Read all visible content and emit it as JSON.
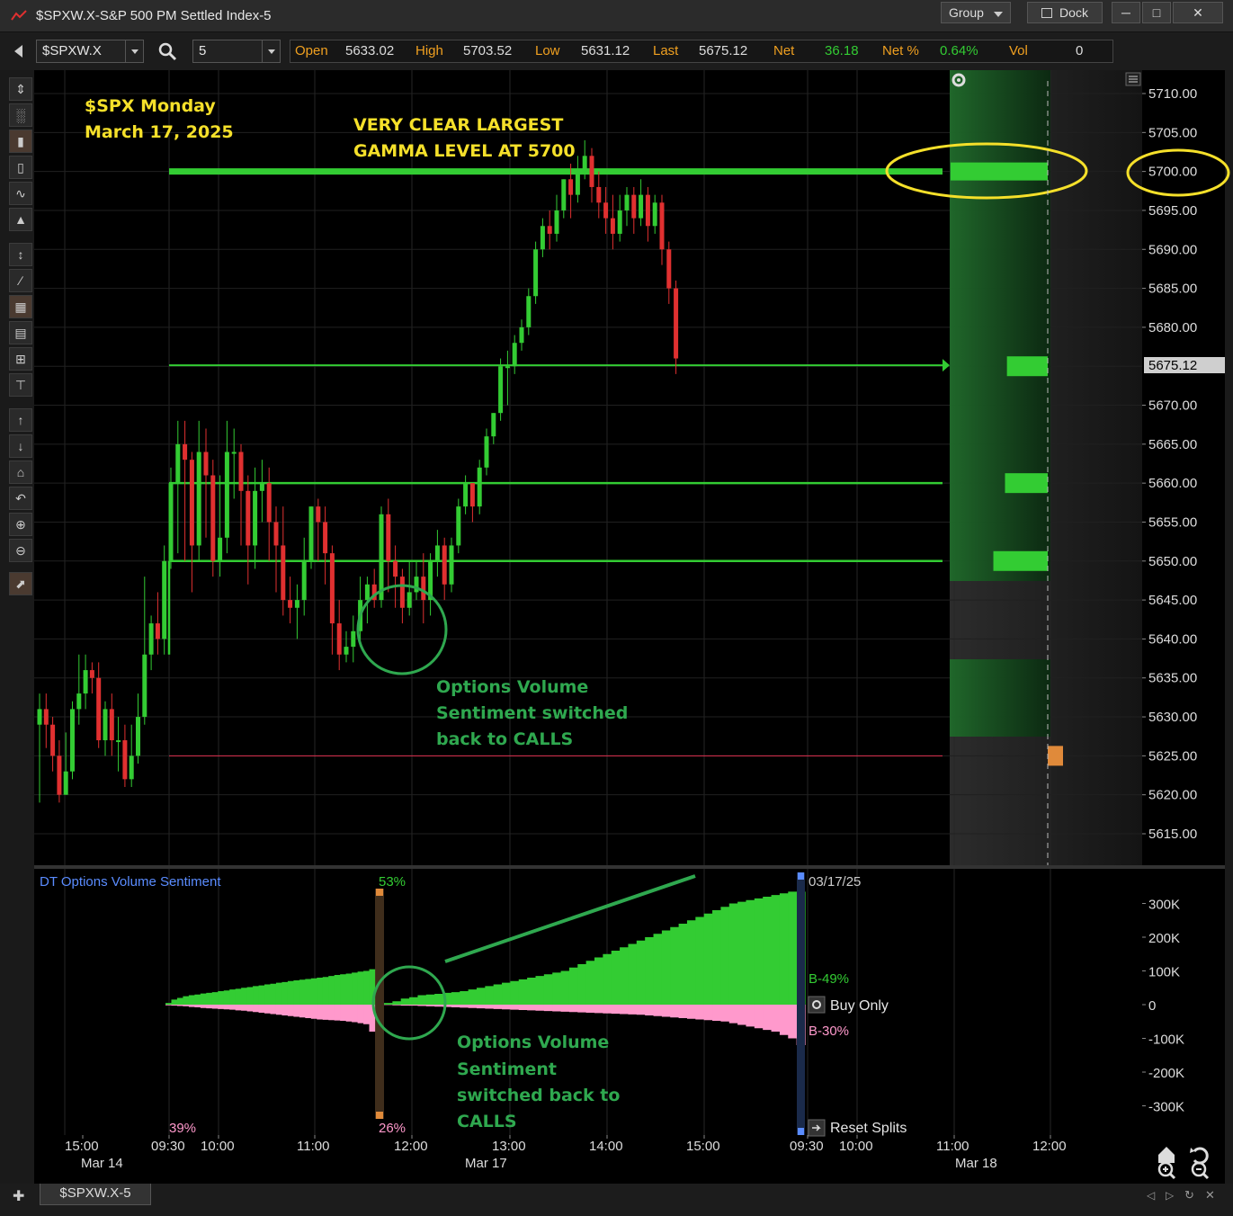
{
  "window": {
    "title": "$SPXW.X-S&P 500 PM Settled Index-5",
    "group_label": "Group",
    "dock_label": "Dock"
  },
  "toolbar": {
    "symbol": "$SPXW.X",
    "interval": "5",
    "quotes": [
      {
        "label": "Open",
        "value": "5633.02"
      },
      {
        "label": "High",
        "value": "5703.52"
      },
      {
        "label": "Low",
        "value": "5631.12"
      },
      {
        "label": "Last",
        "value": "5675.12"
      },
      {
        "label": "Net",
        "value": "36.18"
      },
      {
        "label": "Net %",
        "value": "0.64%"
      },
      {
        "label": "Vol",
        "value": "0"
      }
    ]
  },
  "colors": {
    "up": "#33cc33",
    "down": "#e03030",
    "annotation_yellow": "#f5e02a",
    "annotation_green": "#2fa84f",
    "sentiment_call": "#33cc33",
    "sentiment_put": "#ff99cc",
    "label_blue": "#5a8cff"
  },
  "annotations": {
    "title_line1": "$SPX Monday",
    "title_line2": "March 17, 2025",
    "gamma_line1": "VERY CLEAR LARGEST",
    "gamma_line2": "GAMMA LEVEL AT 5700",
    "sentiment_top": [
      "Options Volume",
      "Sentiment switched",
      "back to CALLS"
    ],
    "sentiment_bottom": [
      "Options Volume",
      "Sentiment",
      "switched back to",
      "CALLS"
    ]
  },
  "price_panel": {
    "last_price_label": "5675.12",
    "ylabels": [
      "5710.00",
      "5705.00",
      "5700.00",
      "5695.00",
      "5690.00",
      "5685.00",
      "5680.00",
      "5675.12",
      "5670.00",
      "5665.00",
      "5660.00",
      "5655.00",
      "5650.00",
      "5645.00",
      "5640.00",
      "5635.00",
      "5630.00",
      "5625.00",
      "5620.00",
      "5615.00"
    ]
  },
  "sentiment_panel": {
    "title": "DT Options Volume Sentiment",
    "date_label": "03/17/25",
    "pct_top": "53%",
    "pct_left": "39%",
    "pct_mid": "26%",
    "b_call": "B-49%",
    "b_put": "B-30%",
    "buy_only": "Buy Only",
    "reset_splits": "Reset Splits",
    "ylabels": [
      "300K",
      "200K",
      "100K",
      "0",
      "-100K",
      "-200K",
      "-300K"
    ]
  },
  "time_axis": {
    "times": [
      "15:00",
      "09:30",
      "10:00",
      "11:00",
      "12:00",
      "13:00",
      "14:00",
      "15:00",
      "09:30",
      "10:00",
      "11:00",
      "12:00"
    ],
    "dates": [
      "Mar 14",
      "Mar 17",
      "Mar 18"
    ]
  },
  "tab": {
    "label": "$SPXW.X-5"
  },
  "chart_data": {
    "type": "candlestick",
    "symbol": "$SPXW.X",
    "interval_minutes": 5,
    "ylim": [
      5612,
      5714
    ],
    "open": 5633.02,
    "high": 5703.52,
    "low": 5631.12,
    "last": 5675.12,
    "levels": [
      {
        "price": 5700,
        "label": "Largest gamma"
      },
      {
        "price": 5675.12,
        "label": "Last"
      },
      {
        "price": 5660
      },
      {
        "price": 5650
      },
      {
        "price": 5625
      }
    ],
    "profile_bars": [
      {
        "price": 5700,
        "size": 1.0
      },
      {
        "price": 5675,
        "size": 0.42
      },
      {
        "price": 5660,
        "size": 0.44
      },
      {
        "price": 5650,
        "size": 0.56
      },
      {
        "price": 5625,
        "size": 0.16
      }
    ],
    "candles": [
      [
        5629,
        5631,
        5619,
        5633
      ],
      [
        5631,
        5629,
        5626,
        5633
      ],
      [
        5629,
        5625,
        5623,
        5630
      ],
      [
        5625,
        5620,
        5619,
        5627
      ],
      [
        5620,
        5623,
        5620,
        5628
      ],
      [
        5623,
        5631,
        5622,
        5632
      ],
      [
        5631,
        5633,
        5629,
        5638
      ],
      [
        5633,
        5636,
        5631,
        5638
      ],
      [
        5636,
        5635,
        5633,
        5637
      ],
      [
        5635,
        5627,
        5626,
        5637
      ],
      [
        5627,
        5631,
        5625,
        5632
      ],
      [
        5631,
        5627,
        5625,
        5633
      ],
      [
        5627,
        5627,
        5623,
        5630
      ],
      [
        5627,
        5622,
        5621,
        5629
      ],
      [
        5622,
        5625,
        5621,
        5629
      ],
      [
        5625,
        5630,
        5624,
        5633
      ],
      [
        5630,
        5638,
        5629,
        5648
      ],
      [
        5638,
        5642,
        5636,
        5643
      ],
      [
        5642,
        5640,
        5638,
        5646
      ],
      [
        5640,
        5650,
        5638,
        5652
      ],
      [
        5650,
        5660,
        5649,
        5662
      ],
      [
        5660,
        5665,
        5651,
        5668
      ],
      [
        5665,
        5663,
        5650,
        5668
      ],
      [
        5663,
        5652,
        5646,
        5664
      ],
      [
        5652,
        5664,
        5650,
        5668
      ],
      [
        5664,
        5661,
        5653,
        5667
      ],
      [
        5661,
        5650,
        5648,
        5663
      ],
      [
        5650,
        5653,
        5648,
        5661
      ],
      [
        5653,
        5664,
        5651,
        5668
      ],
      [
        5664,
        5664,
        5658,
        5667
      ],
      [
        5664,
        5659,
        5652,
        5665
      ],
      [
        5659,
        5652,
        5647,
        5661
      ],
      [
        5652,
        5659,
        5649,
        5662
      ],
      [
        5659,
        5660,
        5655,
        5663
      ],
      [
        5660,
        5655,
        5650,
        5662
      ],
      [
        5655,
        5652,
        5646,
        5657
      ],
      [
        5652,
        5645,
        5643,
        5657
      ],
      [
        5645,
        5644,
        5642,
        5648
      ],
      [
        5644,
        5645,
        5640,
        5647
      ],
      [
        5645,
        5650,
        5643,
        5653
      ],
      [
        5650,
        5657,
        5649,
        5657
      ],
      [
        5657,
        5655,
        5650,
        5658
      ],
      [
        5655,
        5651,
        5647,
        5657
      ],
      [
        5651,
        5642,
        5638,
        5652
      ],
      [
        5642,
        5638,
        5636,
        5645
      ],
      [
        5638,
        5639,
        5637,
        5641
      ],
      [
        5639,
        5641,
        5637,
        5643
      ],
      [
        5641,
        5645,
        5639,
        5648
      ],
      [
        5645,
        5647,
        5642,
        5648
      ],
      [
        5647,
        5645,
        5644,
        5649
      ],
      [
        5645,
        5656,
        5644,
        5657
      ],
      [
        5656,
        5650,
        5646,
        5658
      ],
      [
        5650,
        5648,
        5644,
        5652
      ],
      [
        5648,
        5644,
        5642,
        5649
      ],
      [
        5644,
        5646,
        5643,
        5650
      ],
      [
        5646,
        5648,
        5645,
        5650
      ],
      [
        5648,
        5645,
        5642,
        5651
      ],
      [
        5645,
        5650,
        5643,
        5651
      ],
      [
        5650,
        5652,
        5648,
        5654
      ],
      [
        5652,
        5647,
        5645,
        5653
      ],
      [
        5647,
        5652,
        5646,
        5653
      ],
      [
        5652,
        5657,
        5651,
        5658
      ],
      [
        5657,
        5660,
        5656,
        5661
      ],
      [
        5660,
        5657,
        5655,
        5660
      ],
      [
        5657,
        5662,
        5656,
        5663
      ],
      [
        5662,
        5666,
        5661,
        5667
      ],
      [
        5666,
        5669,
        5665,
        5669
      ],
      [
        5669,
        5675,
        5668,
        5676
      ],
      [
        5675,
        5675,
        5670,
        5677
      ],
      [
        5675,
        5678,
        5674,
        5679
      ],
      [
        5678,
        5680,
        5677,
        5681
      ],
      [
        5680,
        5684,
        5679,
        5685
      ],
      [
        5684,
        5690,
        5683,
        5691
      ],
      [
        5690,
        5693,
        5689,
        5694
      ],
      [
        5693,
        5692,
        5690,
        5695
      ],
      [
        5692,
        5695,
        5691,
        5697
      ],
      [
        5695,
        5699,
        5694,
        5699
      ],
      [
        5699,
        5697,
        5694,
        5701
      ],
      [
        5697,
        5700,
        5696,
        5702
      ],
      [
        5700,
        5702,
        5699,
        5704
      ],
      [
        5702,
        5698,
        5696,
        5703
      ],
      [
        5698,
        5696,
        5694,
        5700
      ],
      [
        5696,
        5694,
        5692,
        5698
      ],
      [
        5694,
        5692,
        5690,
        5697
      ],
      [
        5692,
        5695,
        5691,
        5697
      ],
      [
        5695,
        5697,
        5693,
        5698
      ],
      [
        5697,
        5694,
        5692,
        5698
      ],
      [
        5694,
        5697,
        5693,
        5699
      ],
      [
        5697,
        5693,
        5691,
        5698
      ],
      [
        5693,
        5696,
        5692,
        5697
      ],
      [
        5696,
        5690,
        5688,
        5697
      ],
      [
        5690,
        5685,
        5683,
        5691
      ],
      [
        5685,
        5676,
        5674,
        5686
      ]
    ],
    "sentiment": {
      "call_pct": "53%",
      "put_pct": "26%",
      "call_b": "B-49%",
      "put_b": "B-30%",
      "ylim": [
        -350,
        350
      ],
      "units": "K",
      "session1_calls": [
        5,
        15,
        20,
        25,
        28,
        30,
        33,
        35,
        37,
        40,
        42,
        45,
        47,
        50,
        52,
        55,
        57,
        60,
        62,
        65,
        67,
        70,
        72,
        74,
        76,
        78,
        80,
        82,
        85,
        88,
        90,
        92,
        95,
        98,
        100,
        105
      ],
      "session1_puts": [
        -2,
        -3,
        -4,
        -5,
        -7,
        -8,
        -10,
        -11,
        -12,
        -13,
        -14,
        -15,
        -17,
        -18,
        -20,
        -22,
        -24,
        -26,
        -28,
        -30,
        -32,
        -34,
        -36,
        -38,
        -40,
        -42,
        -44,
        -45,
        -46,
        -47,
        -48,
        -50,
        -52,
        -55,
        -58,
        -80
      ],
      "session2_calls": [
        5,
        10,
        18,
        22,
        28,
        30,
        32,
        35,
        37,
        40,
        45,
        50,
        55,
        60,
        65,
        70,
        75,
        80,
        85,
        90,
        95,
        100,
        110,
        120,
        130,
        140,
        150,
        160,
        170,
        180,
        190,
        200,
        210,
        220,
        230,
        240,
        250,
        260,
        270,
        280,
        290,
        300,
        305,
        310,
        315,
        320,
        325,
        330,
        335,
        335
      ],
      "session2_puts": [
        -1,
        -2,
        -3,
        -3,
        -4,
        -5,
        -6,
        -7,
        -8,
        -9,
        -10,
        -11,
        -12,
        -13,
        -14,
        -15,
        -16,
        -17,
        -18,
        -19,
        -20,
        -21,
        -22,
        -23,
        -24,
        -25,
        -26,
        -27,
        -28,
        -29,
        -30,
        -32,
        -34,
        -36,
        -38,
        -40,
        -42,
        -44,
        -46,
        -48,
        -50,
        -55,
        -60,
        -65,
        -70,
        -75,
        -80,
        -90,
        -100,
        -120
      ]
    }
  }
}
